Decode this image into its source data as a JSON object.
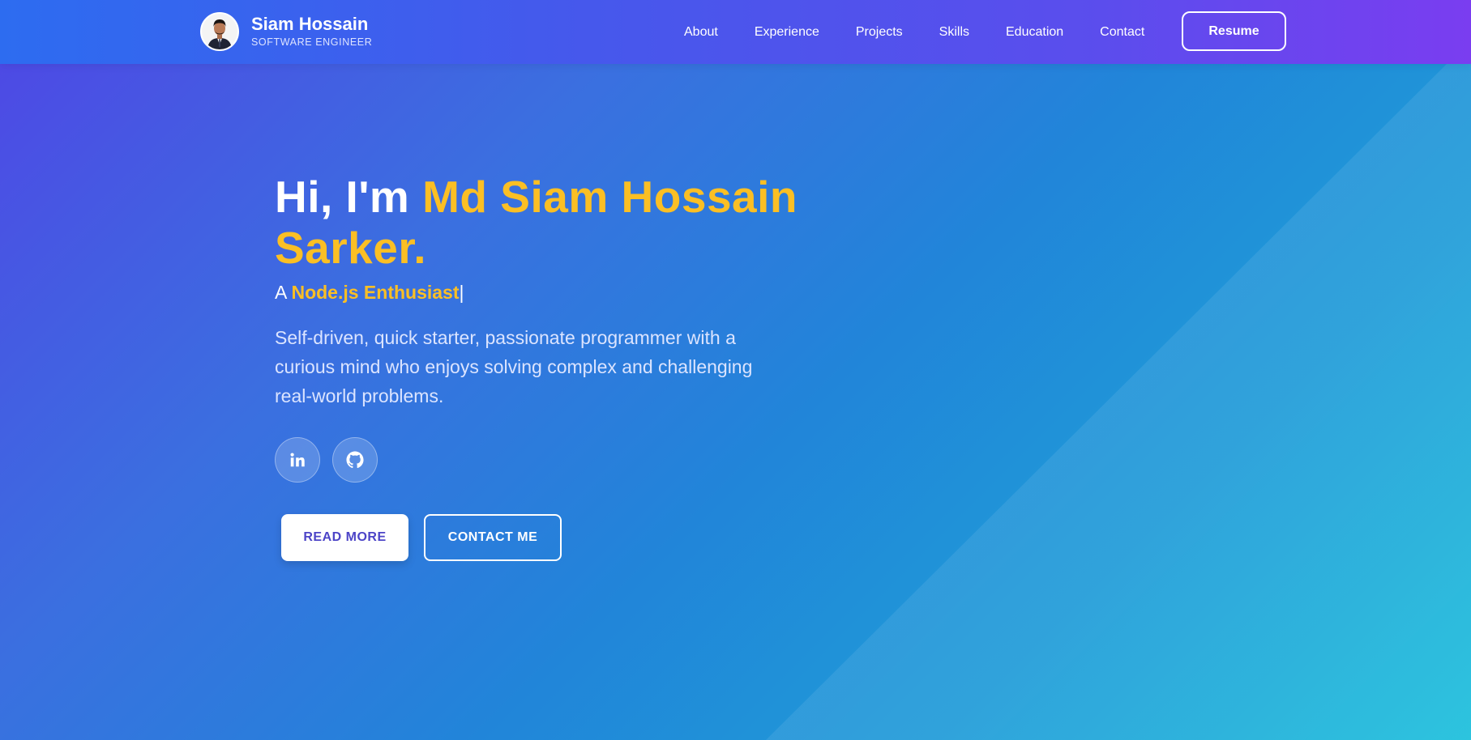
{
  "brand": {
    "name": "Siam Hossain",
    "role": "SOFTWARE ENGINEER"
  },
  "nav": {
    "items": [
      "About",
      "Experience",
      "Projects",
      "Skills",
      "Education",
      "Contact"
    ],
    "resume_label": "Resume"
  },
  "hero": {
    "greeting": "Hi, I'm ",
    "name": "Md Siam Hossain Sarker.",
    "subtitle_prefix": "A ",
    "subtitle_role": "Node.js Enthusiast",
    "cursor": "|",
    "description": "Self-driven, quick starter, passionate programmer with a curious mind who enjoys solving complex and challenging real-world problems.",
    "socials": [
      "linkedin-icon",
      "github-icon"
    ],
    "read_more_label": "READ MORE",
    "contact_label": "CONTACT ME"
  },
  "colors": {
    "accent": "#fbbf24",
    "button_text": "#4c44c7"
  }
}
